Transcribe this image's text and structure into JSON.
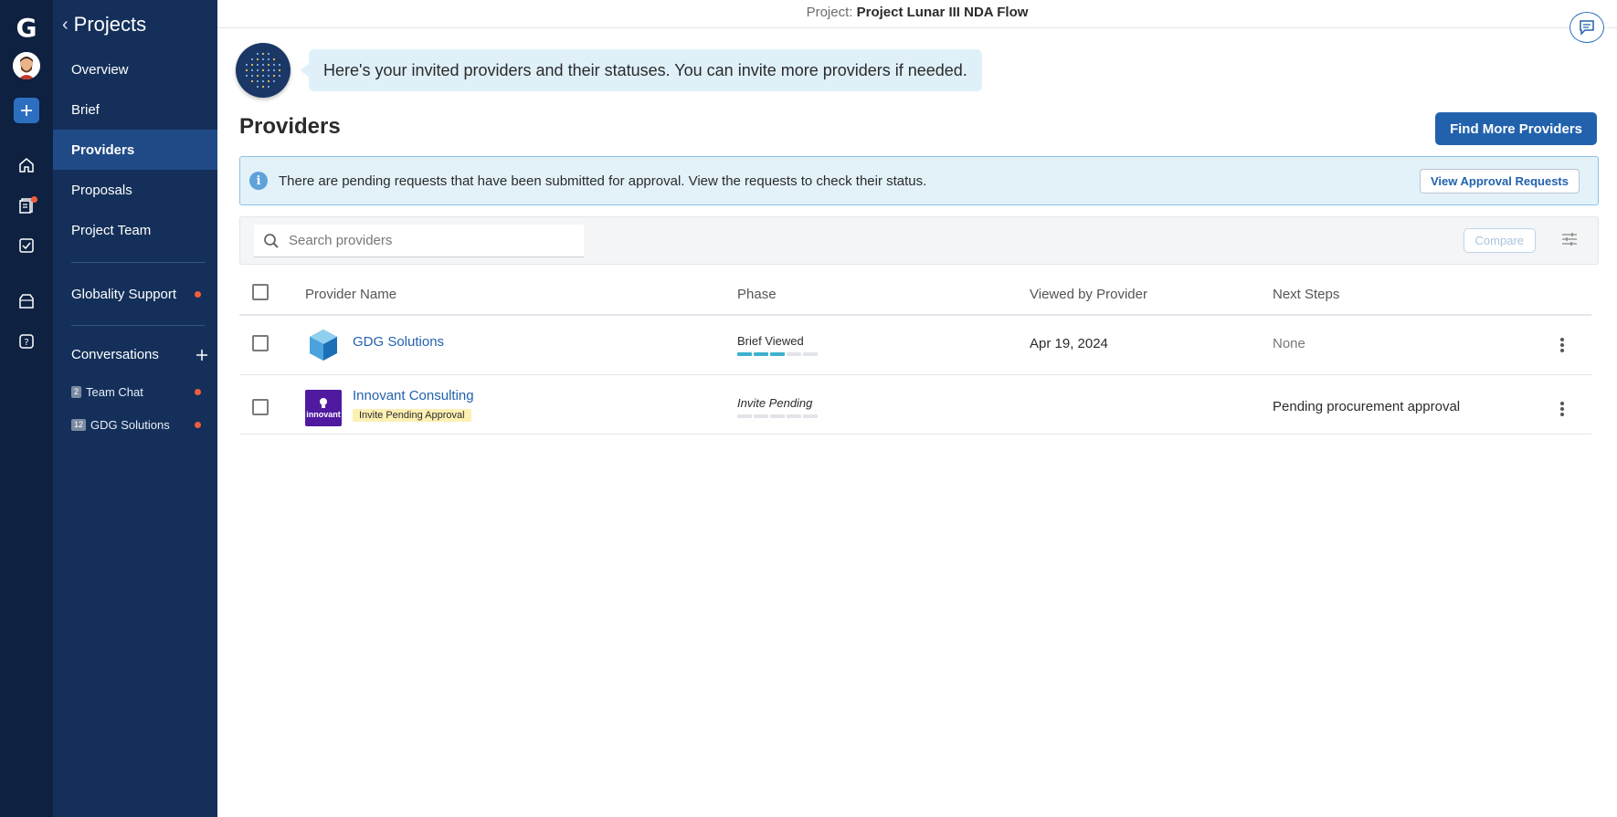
{
  "rail": {
    "logo": "G",
    "icons": [
      "avatar",
      "add-icon",
      "home-icon",
      "documents-icon",
      "tasks-icon",
      "inbox-icon",
      "help-icon"
    ]
  },
  "nav": {
    "back_label": "Projects",
    "links": [
      "Overview",
      "Brief",
      "Providers",
      "Proposals",
      "Project Team"
    ],
    "active": "Providers",
    "support": "Globality Support",
    "conversations_label": "Conversations",
    "conversations": [
      {
        "count": "2",
        "label": "Team Chat"
      },
      {
        "count": "12",
        "label": "GDG Solutions"
      }
    ]
  },
  "topbar": {
    "project_label": "Project:",
    "project_name": "Project Lunar III NDA Flow"
  },
  "assistant": {
    "message": "Here's your invited providers and their statuses. You can invite more providers if needed."
  },
  "page": {
    "title": "Providers",
    "find_button": "Find More Providers"
  },
  "alert": {
    "text": "There are pending requests that have been submitted for approval. View the requests to check their status.",
    "button": "View Approval Requests"
  },
  "toolbar": {
    "search_placeholder": "Search providers",
    "compare_button": "Compare"
  },
  "table": {
    "headers": {
      "name": "Provider Name",
      "phase": "Phase",
      "viewed": "Viewed by Provider",
      "next": "Next Steps"
    },
    "rows": [
      {
        "name": "GDG Solutions",
        "badge": "",
        "phase": "Brief Viewed",
        "phase_progress": 3,
        "phase_total": 5,
        "viewed": "Apr 19, 2024",
        "next": "None"
      },
      {
        "name": "Innovant Consulting",
        "badge": "Invite Pending Approval",
        "logo_text": "innovant",
        "phase": "Invite Pending",
        "phase_progress": 0,
        "phase_total": 5,
        "viewed": "",
        "next": "Pending procurement approval"
      }
    ]
  },
  "colors": {
    "rail_bg": "#0e2141",
    "nav_bg": "#14305a",
    "nav_active": "#204a86",
    "primary": "#2262ad",
    "alert_bg": "#e3f2f9",
    "phase_on": "#3db1cf",
    "notification": "#f25c3b"
  }
}
